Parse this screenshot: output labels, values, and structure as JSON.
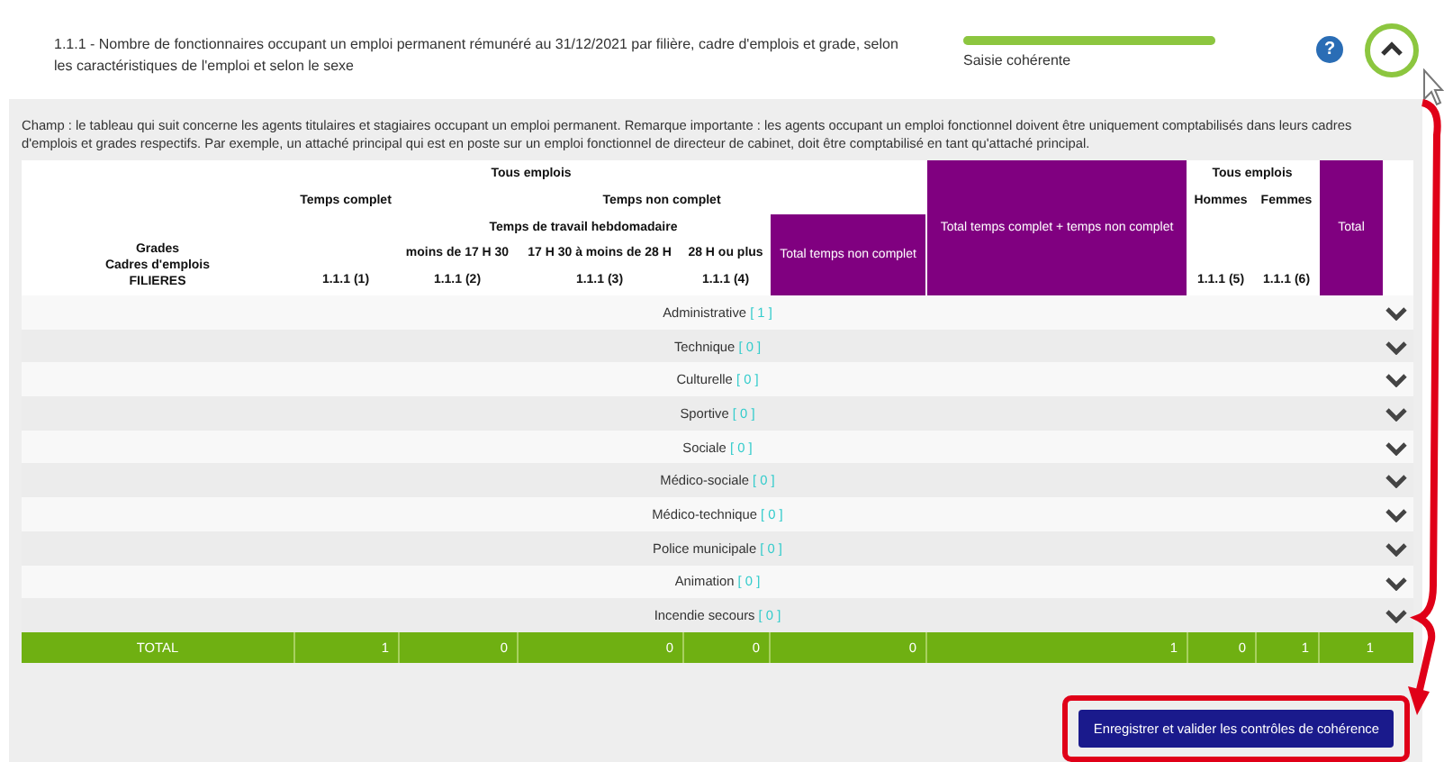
{
  "section": {
    "title": "1.1.1 - Nombre de fonctionnaires occupant un emploi permanent rémunéré au 31/12/2021 par filière, cadre d'emplois et grade, selon les caractéristiques de l'emploi et selon le sexe",
    "status": {
      "label": "Saisie cohérente",
      "level": 1
    },
    "help": "?",
    "expanded": true
  },
  "description": "Champ : le tableau qui suit concerne les agents titulaires et stagiaires occupant un emploi permanent. Remarque importante : les agents occupant un emploi fonctionnel doivent être uniquement comptabilisés dans leurs cadres d'emplois et grades respectifs. Par exemple, un attaché principal qui est en poste sur un emploi fonctionnel de directeur de cabinet, doit être comptabilisé en tant qu'attaché principal.",
  "header": {
    "tous_emplois": "Tous emplois",
    "temps_complet": "Temps complet",
    "temps_non_complet": "Temps non complet",
    "temps_travail": "Temps de travail hebdomadaire",
    "moins_17h30": "moins de 17 H 30",
    "de_17h30_a_28h": "17 H 30 à moins de 28 H",
    "plus_28h": "28 H ou plus",
    "total_non_complet": "Total temps non complet",
    "total_complet_non_complet": "Total temps complet + temps non complet",
    "tous_emplois_sexe": "Tous emplois",
    "hommes": "Hommes",
    "femmes": "Femmes",
    "total": "Total",
    "row_labels": [
      "Grades",
      "Cadres d'emplois",
      "FILIERES"
    ],
    "codes": [
      "1.1.1 (1)",
      "1.1.1 (2)",
      "1.1.1 (3)",
      "1.1.1 (4)",
      "1.1.1 (5)",
      "1.1.1 (6)"
    ]
  },
  "rows": [
    {
      "name": "Administrative",
      "count": "[ 1 ]",
      "expanded": false
    },
    {
      "name": "Technique",
      "count": "[ 0 ]",
      "expanded": false
    },
    {
      "name": "Culturelle",
      "count": "[ 0 ]",
      "expanded": false
    },
    {
      "name": "Sportive",
      "count": "[ 0 ]",
      "expanded": false
    },
    {
      "name": "Sociale",
      "count": "[ 0 ]",
      "expanded": false
    },
    {
      "name": "Médico-sociale",
      "count": "[ 0 ]",
      "expanded": false
    },
    {
      "name": "Médico-technique",
      "count": "[ 0 ]",
      "expanded": false
    },
    {
      "name": "Police municipale",
      "count": "[ 0 ]",
      "expanded": false
    },
    {
      "name": "Animation",
      "count": "[ 0 ]",
      "expanded": false
    },
    {
      "name": "Incendie secours",
      "count": "[ 0 ]",
      "expanded": false
    }
  ],
  "total_row": {
    "label": "TOTAL",
    "values": [
      "1",
      "0",
      "0",
      "0",
      "0",
      "1",
      "0",
      "1",
      "1"
    ]
  },
  "save_button": "Enregistrer et valider les contrôles de cohérence"
}
